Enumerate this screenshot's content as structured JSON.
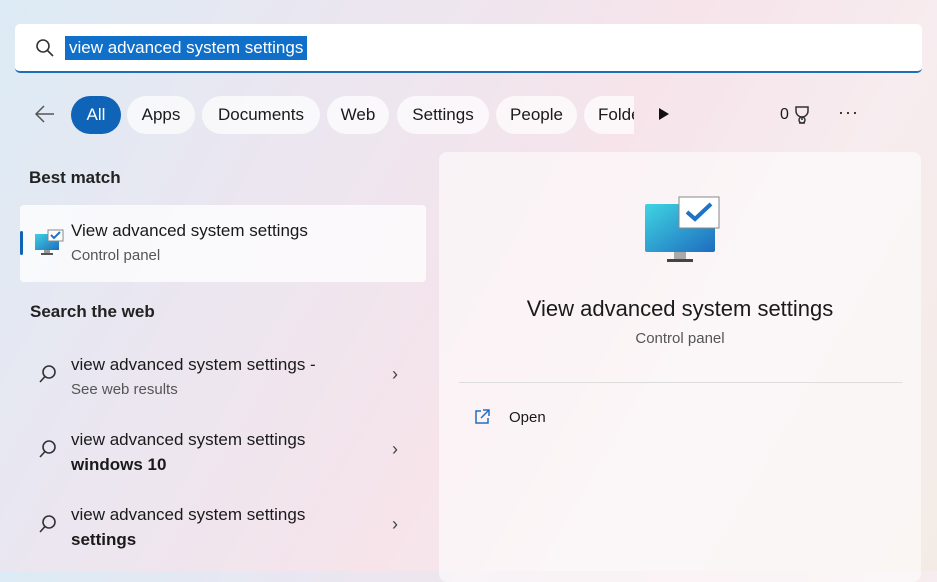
{
  "search": {
    "query": "view advanced system settings"
  },
  "filters": {
    "chips": [
      "All",
      "Apps",
      "Documents",
      "Web",
      "Settings",
      "People",
      "Folde"
    ],
    "points": "0"
  },
  "best_match": {
    "heading": "Best match",
    "title": "View advanced system settings",
    "subtitle": "Control panel"
  },
  "web": {
    "heading": "Search the web",
    "results": [
      {
        "line1": "view advanced system settings -",
        "line2": "See web results",
        "bold": false
      },
      {
        "line1": "view advanced system settings",
        "line2": "windows 10",
        "bold": true
      },
      {
        "line1": "view advanced system settings",
        "line2": "settings",
        "bold": true
      }
    ]
  },
  "detail": {
    "title": "View advanced system settings",
    "subtitle": "Control panel",
    "open_label": "Open"
  },
  "colors": {
    "accent": "#0f64b8"
  }
}
